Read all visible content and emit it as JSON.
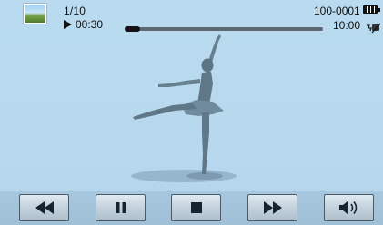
{
  "status": {
    "counter": "1/10",
    "elapsed": "00:30",
    "folder_file": "100-0001",
    "total": "10:00"
  },
  "playback": {
    "progress": 0.08
  },
  "icons": {
    "thumbnail": "thumbnail-icon",
    "play_indicator": "play-icon",
    "battery": "battery-full-icon",
    "ois": "shake-off-icon"
  },
  "controls": [
    {
      "name": "rewind",
      "icon": "rewind-icon"
    },
    {
      "name": "pause",
      "icon": "pause-icon"
    },
    {
      "name": "stop",
      "icon": "stop-icon"
    },
    {
      "name": "fast_forward",
      "icon": "fast-forward-icon"
    },
    {
      "name": "volume",
      "icon": "volume-icon"
    }
  ],
  "colors": {
    "background": "#b9daef",
    "icon": "#17232e",
    "progress_fill": "#141414",
    "progress_track": "#5d6770"
  }
}
